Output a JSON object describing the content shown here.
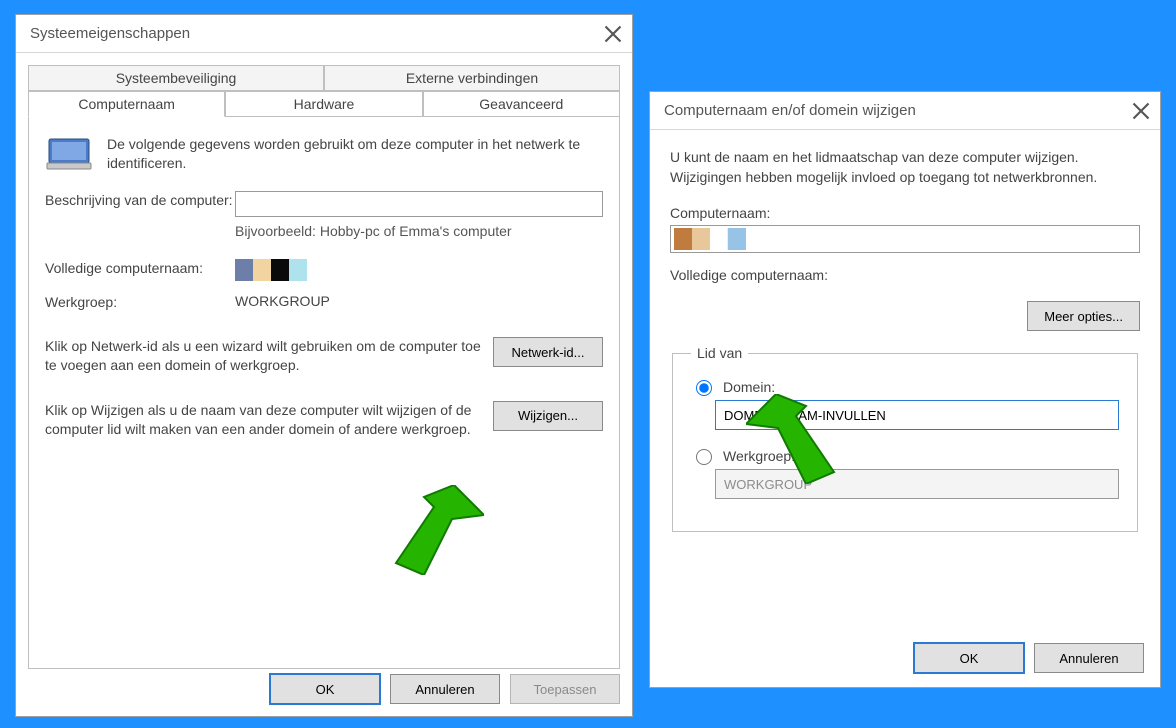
{
  "sys": {
    "title": "Systeemeigenschappen",
    "tabs_row1": [
      "Systeembeveiliging",
      "Externe verbindingen"
    ],
    "tabs_row2": [
      "Computernaam",
      "Hardware",
      "Geavanceerd"
    ],
    "intro": "De volgende gegevens worden gebruikt om deze computer in het netwerk te identificeren.",
    "desc_label": "Beschrijving van de computer:",
    "desc_value": "",
    "desc_hint": "Bijvoorbeeld: Hobby-pc of Emma's computer",
    "fullname_label": "Volledige computernaam:",
    "workgroup_label": "Werkgroep:",
    "workgroup_value": "WORKGROUP",
    "netid_text": "Klik op Netwerk-id als u een wizard wilt gebruiken om de computer toe te voegen aan een domein of werkgroep.",
    "netid_btn": "Netwerk-id...",
    "change_text": "Klik op Wijzigen als u de naam van deze computer wilt wijzigen of de computer lid wilt maken van een ander domein of andere werkgroep.",
    "change_btn": "Wijzigen...",
    "ok": "OK",
    "cancel": "Annuleren",
    "apply": "Toepassen"
  },
  "nd": {
    "title": "Computernaam en/of domein wijzigen",
    "info": "U kunt de naam en het lidmaatschap van deze computer wijzigen. Wijzigingen hebben mogelijk invloed op toegang tot netwerkbronnen.",
    "name_label": "Computernaam:",
    "name_value": "",
    "fullname_label": "Volledige computernaam:",
    "more_btn": "Meer opties...",
    "member_legend": "Lid van",
    "domain_label": "Domein:",
    "domain_value": "DOMEIN-NAAM-INVULLEN",
    "workgroup_label": "Werkgroep:",
    "workgroup_value": "WORKGROUP",
    "ok": "OK",
    "cancel": "Annuleren"
  },
  "palette": {
    "sys_blocks": [
      "#6d7ea8",
      "#f1d4a0",
      "#0a0a0a",
      "#aee2ec"
    ],
    "name_blocks": [
      "#c07c3e",
      "#e8c79a",
      "#ffffff",
      "#97c3e6"
    ]
  }
}
